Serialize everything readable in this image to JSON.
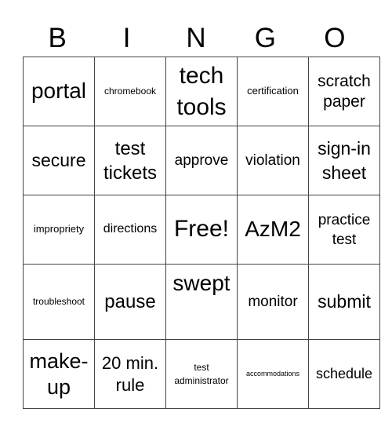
{
  "header": {
    "letters": [
      "B",
      "I",
      "N",
      "G",
      "O"
    ]
  },
  "cells": [
    [
      {
        "text": "portal",
        "size": 28
      },
      {
        "text": "chromebook",
        "size": 12
      },
      {
        "text": "tech tools",
        "size": 30
      },
      {
        "text": "certification",
        "size": 13
      },
      {
        "text": "scratch paper",
        "size": 21
      }
    ],
    [
      {
        "text": "secure",
        "size": 23
      },
      {
        "text": "test tickets",
        "size": 24
      },
      {
        "text": "approve",
        "size": 19
      },
      {
        "text": "violation",
        "size": 19
      },
      {
        "text": "sign-in sheet",
        "size": 23
      }
    ],
    [
      {
        "text": "impropriety",
        "size": 13
      },
      {
        "text": "directions",
        "size": 16
      },
      {
        "text": "Free!",
        "size": 30
      },
      {
        "text": "AzM2",
        "size": 28
      },
      {
        "text": "practice test",
        "size": 19
      }
    ],
    [
      {
        "text": "troubleshoot",
        "size": 12
      },
      {
        "text": "pause",
        "size": 24
      },
      {
        "text": "swept",
        "size": 28
      },
      {
        "text": "monitor",
        "size": 19
      },
      {
        "text": "submit",
        "size": 23
      }
    ],
    [
      {
        "text": "make-up",
        "size": 27
      },
      {
        "text": "20 min. rule",
        "size": 22
      },
      {
        "text": "test administrator",
        "size": 12
      },
      {
        "text": "accommodations",
        "size": 9
      },
      {
        "text": "schedule",
        "size": 18
      }
    ]
  ]
}
